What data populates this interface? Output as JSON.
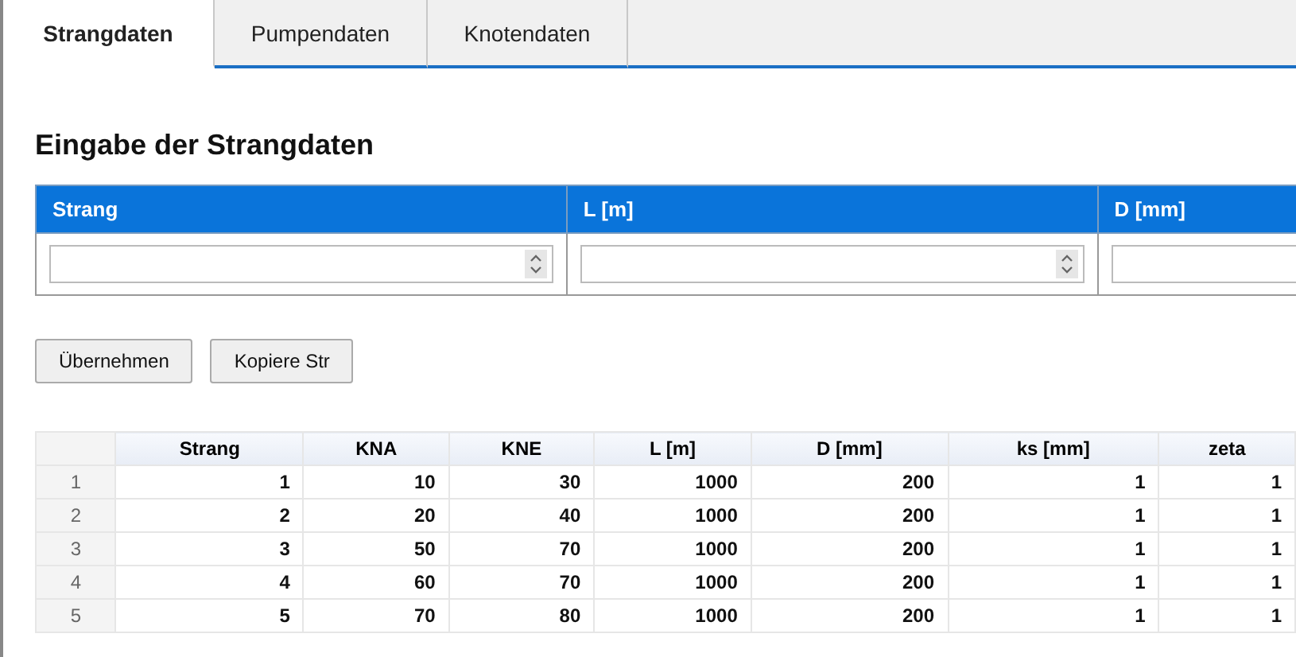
{
  "tabs": [
    {
      "label": "Strangdaten",
      "selected": true
    },
    {
      "label": "Pumpendaten",
      "selected": false
    },
    {
      "label": "Knotendaten",
      "selected": false
    }
  ],
  "heading": "Eingabe der Strangdaten",
  "input_table": {
    "columns": [
      "Strang",
      "L [m]",
      "D [mm]"
    ]
  },
  "buttons": [
    "Übernehmen",
    "Kopiere Str"
  ],
  "grid": {
    "columns": [
      "Strang",
      "KNA",
      "KNE",
      "L [m]",
      "D [mm]",
      "ks [mm]",
      "zeta"
    ],
    "rows": [
      {
        "number": "1",
        "cells": [
          "1",
          "10",
          "30",
          "1000",
          "200",
          "1",
          "1"
        ]
      },
      {
        "number": "2",
        "cells": [
          "2",
          "20",
          "40",
          "1000",
          "200",
          "1",
          "1"
        ]
      },
      {
        "number": "3",
        "cells": [
          "3",
          "50",
          "70",
          "1000",
          "200",
          "1",
          "1"
        ]
      },
      {
        "number": "4",
        "cells": [
          "4",
          "60",
          "70",
          "1000",
          "200",
          "1",
          "1"
        ]
      },
      {
        "number": "5",
        "cells": [
          "5",
          "70",
          "80",
          "1000",
          "200",
          "1",
          "1"
        ]
      }
    ]
  }
}
